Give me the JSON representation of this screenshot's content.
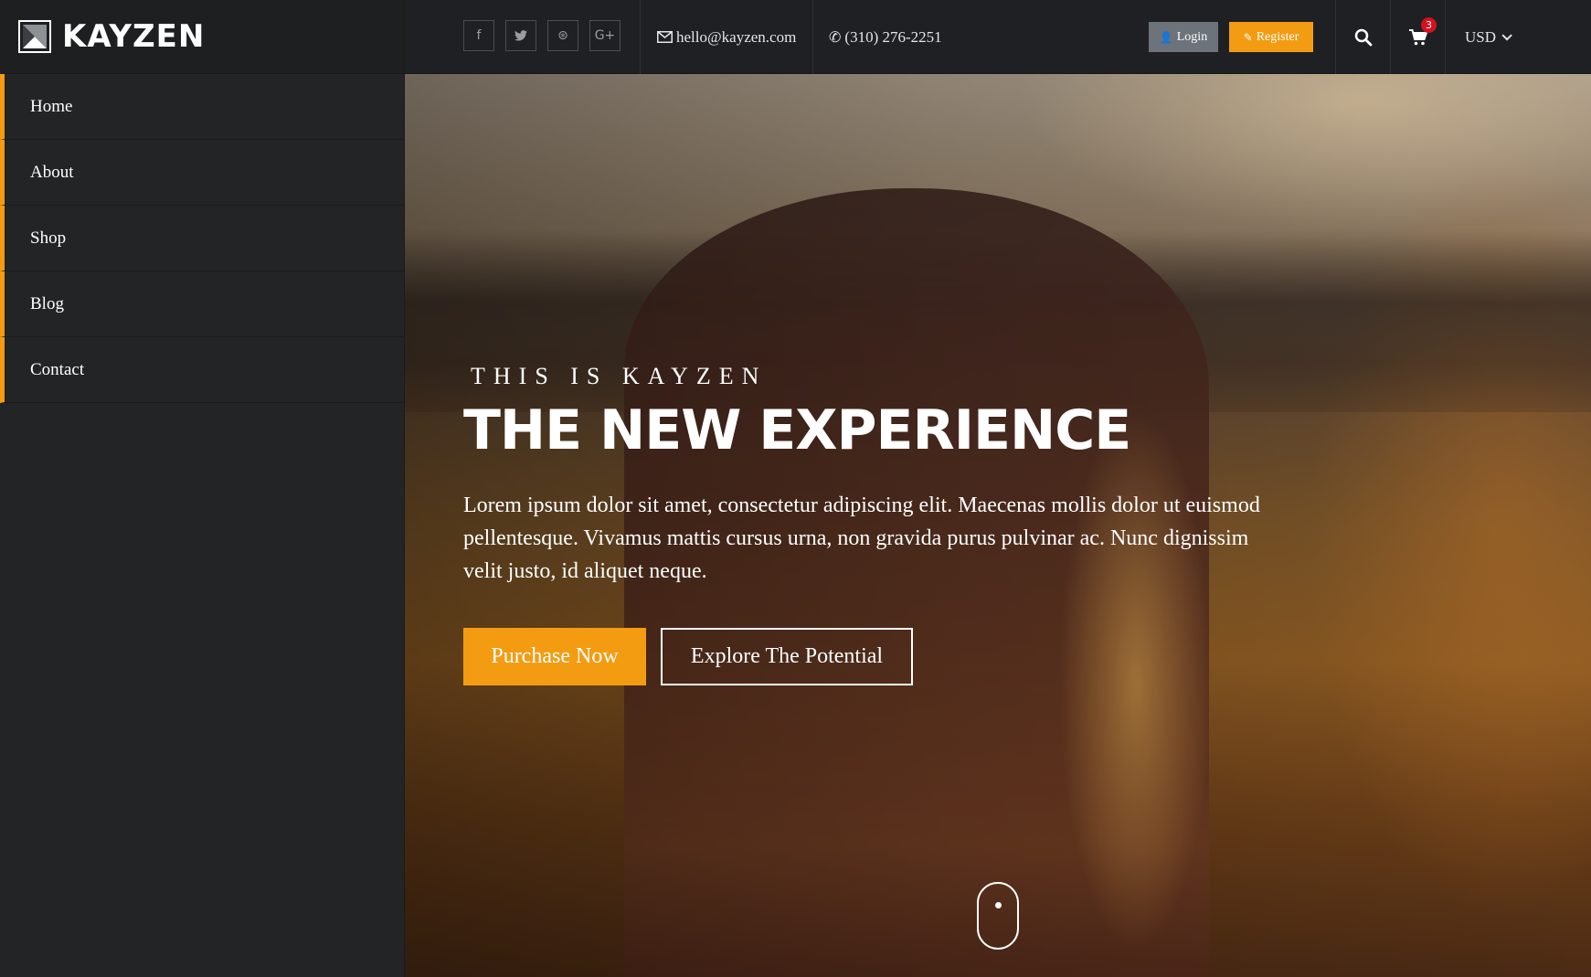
{
  "brand": {
    "name": "KAYZEN",
    "logo_icon": "kayzen-logo-icon"
  },
  "sidebar": {
    "items": [
      {
        "label": "Home"
      },
      {
        "label": "About"
      },
      {
        "label": "Shop"
      },
      {
        "label": "Blog"
      },
      {
        "label": "Contact"
      }
    ]
  },
  "topbar": {
    "social": [
      {
        "icon": "facebook-icon",
        "glyph": "f"
      },
      {
        "icon": "twitter-icon",
        "glyph": "t"
      },
      {
        "icon": "dribbble-icon",
        "glyph": "⊛"
      },
      {
        "icon": "google-plus-icon",
        "glyph": "G+"
      }
    ],
    "email": "hello@kayzen.com",
    "phone": "(310) 276-2251",
    "login_label": "Login",
    "register_label": "Register",
    "cart_count": "3",
    "currency": "USD"
  },
  "hero": {
    "kicker": "THIS IS KAYZEN",
    "headline": "THE NEW EXPERIENCE",
    "lead": "Lorem ipsum dolor sit amet, consectetur adipiscing elit. Maecenas mollis dolor ut euismod pellentesque. Vivamus mattis cursus urna, non gravida purus pulvinar ac. Nunc dignissim velit justo, id aliquet neque.",
    "primary_cta": "Purchase Now",
    "secondary_cta": "Explore The Potential"
  },
  "colors": {
    "accent": "#f39c12",
    "sidebar_bg": "#222426",
    "topbar_bg": "#1e2023",
    "login_bg": "#6c737a",
    "badge": "#d4111e"
  }
}
